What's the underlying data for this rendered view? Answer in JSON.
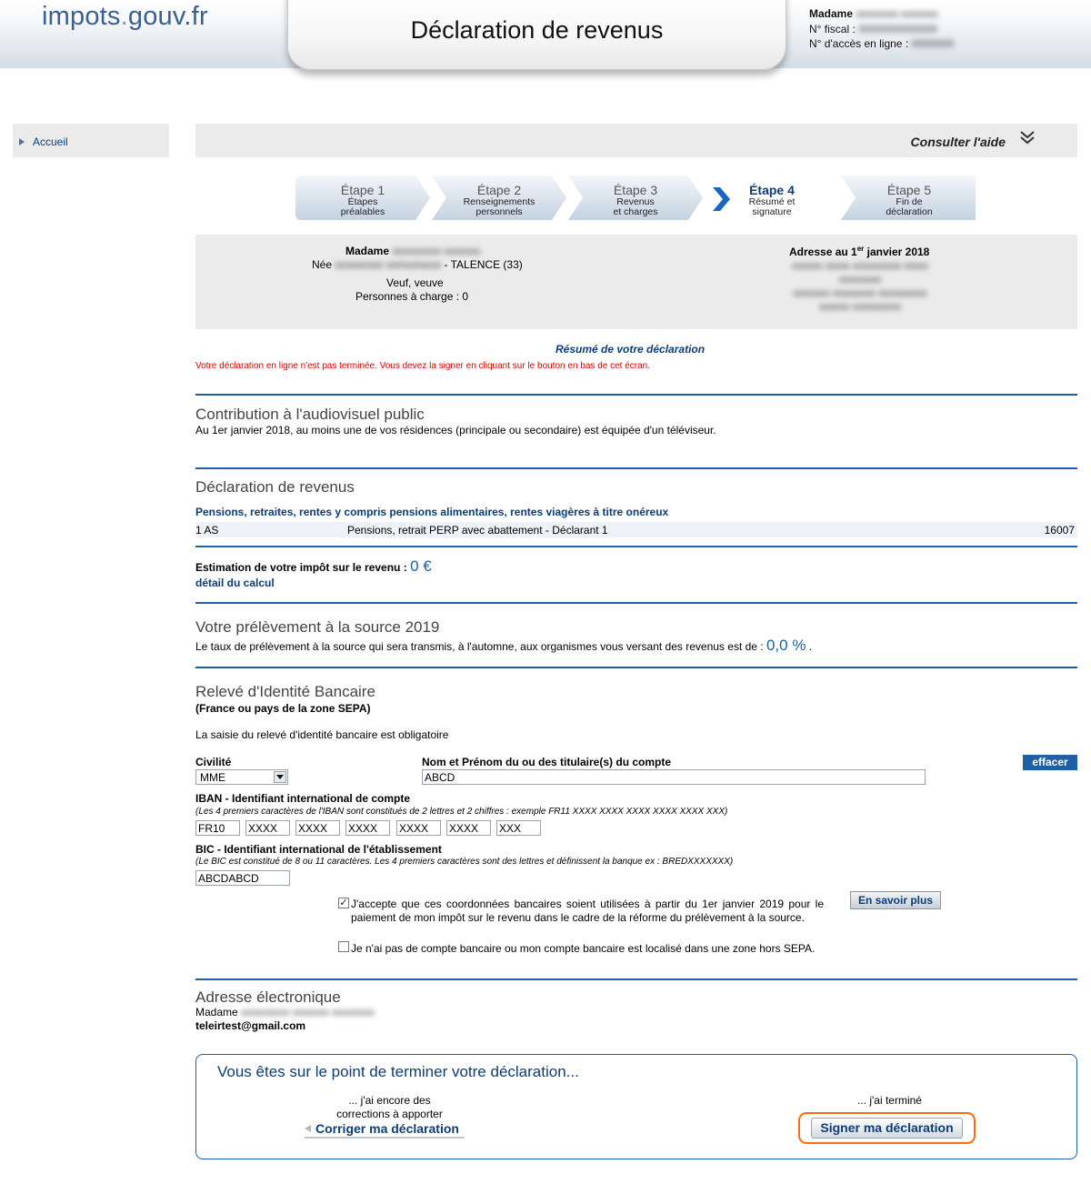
{
  "header": {
    "logo_main": "impots",
    "logo_sep": ".",
    "logo_domain": "gouv.fr",
    "title": "Déclaration de revenus",
    "user": {
      "civility_label": "Madame",
      "fiscal_label": "N° fiscal :",
      "access_label": "N° d'accès en ligne :"
    }
  },
  "sidebar": {
    "home": "Accueil"
  },
  "help": {
    "label": "Consulter l'aide"
  },
  "steps": [
    {
      "num": "Étape 1",
      "line1": "Étapes",
      "line2": "préalables"
    },
    {
      "num": "Étape 2",
      "line1": "Renseignements",
      "line2": "personnels"
    },
    {
      "num": "Étape 3",
      "line1": "Revenus",
      "line2": "et charges"
    },
    {
      "num": "Étape 4",
      "line1": "Résumé et",
      "line2": "signature"
    },
    {
      "num": "Étape 5",
      "line1": "Fin de",
      "line2": "déclaration"
    }
  ],
  "identity": {
    "civility": "Madame",
    "born_prefix": "Née",
    "born_place": "- TALENCE (33)",
    "status": "Veuf, veuve",
    "dependents": "Personnes à charge : 0",
    "address_title_pre": "Adresse au 1",
    "address_title_sup": "er",
    "address_title_post": " janvier 2018"
  },
  "summary": {
    "title": "Résumé de votre déclaration",
    "warning": "Votre déclaration en ligne n'est pas terminée. Vous devez la signer en cliquant sur le bouton en bas de cet écran."
  },
  "audiovisuel": {
    "title": "Contribution à l'audiovisuel public",
    "text": "Au 1er janvier 2018, au moins une de vos résidences (principale ou secondaire) est équipée d'un téléviseur."
  },
  "revenus": {
    "title": "Déclaration de revenus",
    "category": "Pensions, retraites, rentes y compris pensions alimentaires, rentes viagères à titre onéreux",
    "rows": [
      {
        "code": "1 AS",
        "label": "Pensions, retrait PERP avec abattement - Déclarant 1",
        "amount": "16007"
      }
    ]
  },
  "estimation": {
    "label": "Estimation de votre impôt sur le revenu :",
    "value": "0 €",
    "detail_link": "détail du calcul"
  },
  "prelevement": {
    "title": "Votre prélèvement à la source 2019",
    "text": "Le taux de prélèvement à la source qui sera transmis, à l'automne, aux organismes vous versant des revenus est de :",
    "rate": "0,0 %",
    "end": "."
  },
  "rib": {
    "title": "Relevé d'Identité Bancaire",
    "subtitle": "(France ou pays de la zone SEPA)",
    "mandatory": "La saisie du relevé d'identité bancaire est obligatoire",
    "civilite_label": "Civilité",
    "civilite_value": "MME",
    "name_label": "Nom et Prénom du ou des titulaire(s) du compte",
    "name_value": "ABCD",
    "clear_button": "effacer",
    "iban_label": "IBAN - Identifiant international de compte",
    "iban_hint": "(Les 4 premiers caractères de l'IBAN sont constitués de 2 lettres et 2 chiffres : exemple FR11 XXXX XXXX XXXX XXXX XXXX XXX)",
    "iban_fields": [
      "FR10",
      "XXXX",
      "XXXX",
      "XXXX",
      "XXXX",
      "XXXX",
      "XXX"
    ],
    "bic_label": "BIC - Identifiant international de l'établissement",
    "bic_hint": "(Le BIC est constitué de 8 ou 11 caractères. Les 4 premiers caractères sont des lettres et définissent la banque ex : BREDXXXXXXX)",
    "bic_value": "ABCDABCD",
    "accept_text": "J'accepte que ces coordonnées bancaires soient utilisées à partir du 1er janvier 2019 pour le paiement de mon impôt sur le revenu dans le cadre de la réforme du prélèvement à la source.",
    "accept_checked": true,
    "more_button": "En savoir plus",
    "no_account_text": "Je n'ai pas de compte bancaire ou mon compte bancaire est localisé dans une zone hors SEPA.",
    "no_account_checked": false
  },
  "email": {
    "title": "Adresse électronique",
    "civility": "Madame",
    "address": "teleirtest@gmail.com"
  },
  "finish": {
    "title": "Vous êtes sur le point de terminer votre déclaration...",
    "left_hint_1": "... j'ai encore des",
    "left_hint_2": "corrections à apporter",
    "correct_button": "Corriger ma déclaration",
    "right_hint": "... j'ai terminé",
    "sign_button": "Signer ma déclaration"
  },
  "colors": {
    "link_blue": "#0b3d7a",
    "rule_blue": "#1f5fa6",
    "warning_red": "#e00000",
    "highlight_orange": "#ff6a13",
    "panel_gray": "#ebebeb"
  }
}
